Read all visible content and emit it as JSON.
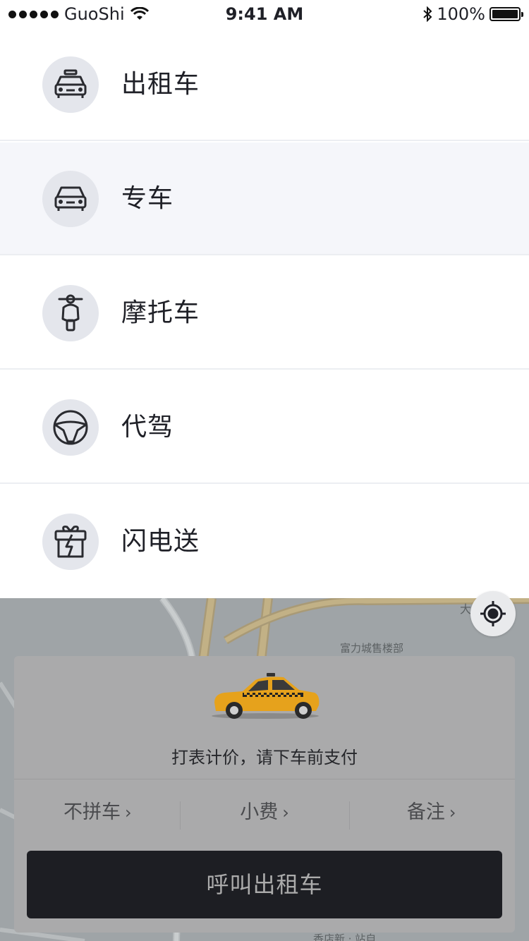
{
  "status_bar": {
    "carrier": "GuoShi",
    "time": "9:41 AM",
    "battery": "100%",
    "battery_level": 1.0
  },
  "menu": {
    "items": [
      {
        "label": "出租车",
        "icon": "taxi-icon"
      },
      {
        "label": "专车",
        "icon": "car-icon"
      },
      {
        "label": "摩托车",
        "icon": "scooter-icon"
      },
      {
        "label": "代驾",
        "icon": "steering-wheel-icon"
      },
      {
        "label": "闪电送",
        "icon": "lightning-delivery-icon"
      }
    ],
    "selected_index": 1
  },
  "map": {
    "poi_labels": [
      "富力城售楼部",
      "大",
      "香店新 · 站自"
    ]
  },
  "card": {
    "fare_text": "打表计价，请下车前支付",
    "options": [
      "不拼车",
      "小费",
      "备注"
    ],
    "call_button": "呼叫出租车"
  },
  "colors": {
    "accent_dark": "#1d1e23",
    "icon_bg": "#e4e6ec",
    "selected_row_bg": "#f5f6fa",
    "taxi_yellow": "#e6a21c"
  }
}
